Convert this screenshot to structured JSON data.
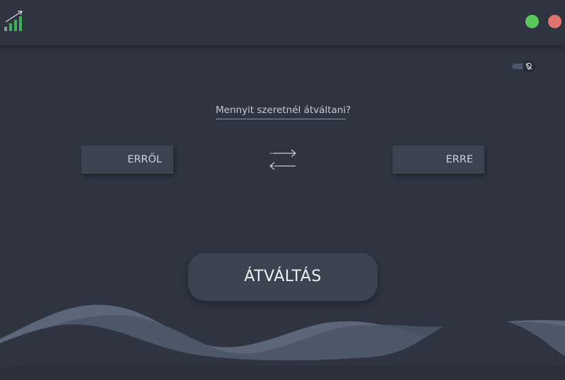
{
  "window": {
    "logo_icon": "growth-chart-icon",
    "minimize_color": "#5ac85a",
    "close_color": "#e0736d"
  },
  "theme_toggle": {
    "icon": "lightbulb-off-icon",
    "state": "off"
  },
  "converter": {
    "question": "Mennyit szeretnél átváltani?",
    "from_label": "ERRŐL",
    "to_label": "ERRE",
    "swap_icon": "swap-arrows-icon",
    "convert_label": "ÁTVÁLTÁS"
  },
  "colors": {
    "background": "#2e3440",
    "panel": "#3b4350",
    "wave_light": "#5b6778",
    "wave_mid": "#4a5565"
  }
}
